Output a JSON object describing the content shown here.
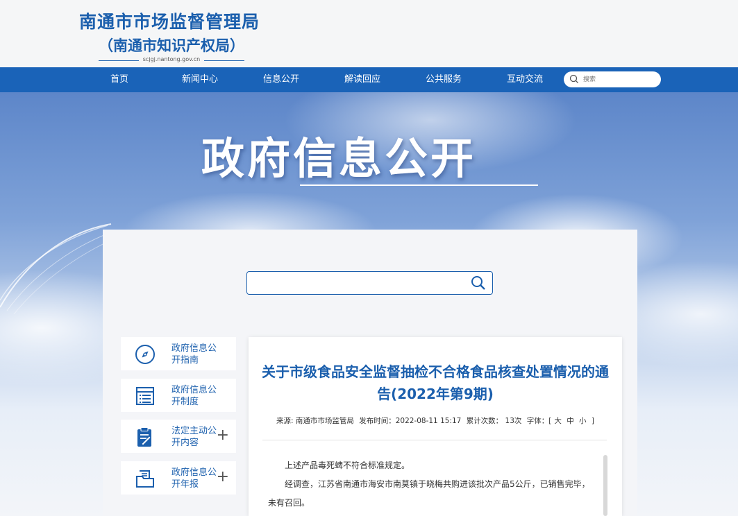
{
  "header": {
    "title": "南通市市场监督管理局",
    "subtitle": "（南通市知识产权局）",
    "url": "scjgj.nantong.gov.cn"
  },
  "nav": {
    "items": [
      {
        "label": "首页"
      },
      {
        "label": "新闻中心"
      },
      {
        "label": "信息公开"
      },
      {
        "label": "解读回应"
      },
      {
        "label": "公共服务"
      },
      {
        "label": "互动交流"
      }
    ],
    "search_placeholder": "搜索"
  },
  "banner": {
    "title": "政府信息公开"
  },
  "sidebar": {
    "items": [
      {
        "label": "政府信息公开指南",
        "icon": "compass-icon"
      },
      {
        "label": "政府信息公开制度",
        "icon": "document-list-icon"
      },
      {
        "label": "法定主动公开内容",
        "icon": "clipboard-pen-icon",
        "expand": "+"
      },
      {
        "label": "政府信息公开年报",
        "icon": "folder-doc-icon",
        "expand": "+"
      }
    ]
  },
  "article": {
    "title": "关于市级食品安全监督抽检不合格食品核查处置情况的通告(2022年第9期)",
    "meta": {
      "source": "来源: 南通市市场监管局",
      "published": "发布时间：2022-08-11 15:17",
      "views": "累计次数： 13次",
      "font_label": "字体：[",
      "font_large": "大",
      "font_medium": "中",
      "font_small": "小",
      "font_end": "]"
    },
    "paragraphs": [
      "上述产品毒死蜱不符合标准规定。",
      "经调查，江苏省南通市海安市南莫镇于晓梅共购进该批次产品5公斤，已销售完毕，未有召回。"
    ]
  },
  "colors": {
    "brand_blue": "#1b5fad",
    "nav_blue": "#1a63b8"
  }
}
